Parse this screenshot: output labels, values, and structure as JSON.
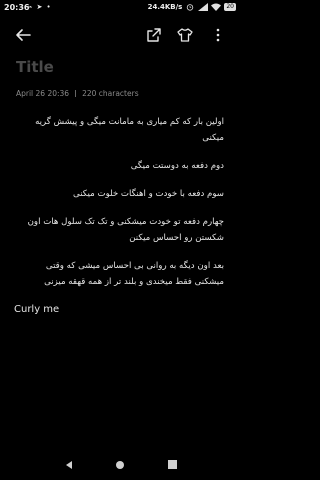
{
  "status": {
    "time": "20:36",
    "notif_icons": "⌁ ➤ •",
    "net_speed": "24.4KB/s",
    "battery": "20"
  },
  "note": {
    "title": "Title",
    "date": "April 26 20:36",
    "char_count": "220 characters",
    "paragraphs": [
      "اولین بار که کم میاری به مامانت میگی و پیشش گریه میکنی",
      "دوم دفعه به دوستت میگی",
      "سوم دفعه با خودت و اهنگات خلوت میکنی",
      "چهارم دفعه تو خودت میشکنی و تک تک سلول هات اون شکستن رو احساس میکنن",
      "بعد اون دیگه به روانی بی احساس میشی که وقتی میشکنی فقط میخندی و بلند تر از همه قهقه میزنی",
      "Curly me"
    ]
  },
  "icons": {
    "back": "arrow-left-icon",
    "share": "share-icon",
    "theme": "shirt-icon",
    "more": "more-vertical-icon"
  }
}
